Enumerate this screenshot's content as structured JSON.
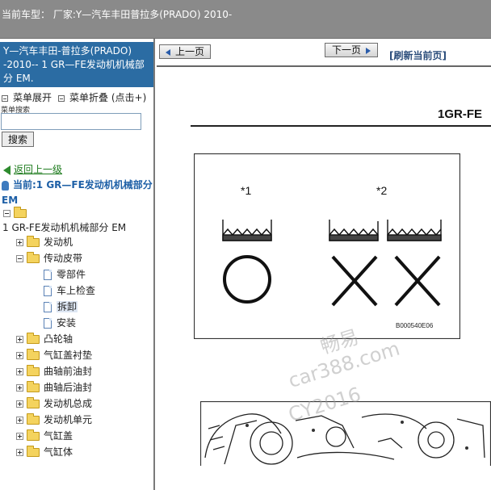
{
  "topbar": {
    "text": "当前车型：  厂家:Y—汽车丰田普拉多(PRADO) 2010-"
  },
  "sidebar": {
    "header": "Y—汽车丰田-普拉多(PRADO) -2010-- 1 GR—FE发动机机械部分 EM.",
    "expand_label": "菜单展开",
    "collapse_label": "菜单折叠 (点击+)",
    "search_label": "菜单搜索",
    "search_value": "",
    "search_button": "搜索",
    "back_label": "返回上一级",
    "current_label": "当前:1 GR—FE发动机机械部分 EM",
    "tree": {
      "root_label": "1 GR-FE发动机机械部分 EM",
      "items": [
        {
          "label": "发动机",
          "expanded": false
        },
        {
          "label": "传动皮带",
          "expanded": true
        },
        {
          "label": "零部件"
        },
        {
          "label": "车上检查"
        },
        {
          "label": "拆卸",
          "selected": true
        },
        {
          "label": "安装"
        },
        {
          "label": "凸轮轴",
          "expanded": false
        },
        {
          "label": "气缸盖衬垫",
          "expanded": false
        },
        {
          "label": "曲轴前油封",
          "expanded": false
        },
        {
          "label": "曲轴后油封",
          "expanded": false
        },
        {
          "label": "发动机总成",
          "expanded": false
        },
        {
          "label": "发动机单元",
          "expanded": false
        },
        {
          "label": "气缸盖",
          "expanded": false
        },
        {
          "label": "气缸体",
          "expanded": false
        }
      ]
    }
  },
  "content": {
    "prev_label": "上一页",
    "next_label": "下一页",
    "refresh_label": "[刷新当前页]",
    "doc_heading": "1GR-FE",
    "figure_marks": [
      "*1",
      "*2"
    ],
    "figure_code": "B000540E06"
  },
  "watermark": {
    "line1": "畅易",
    "line2": "car388.com",
    "line3": "CY2016"
  },
  "colors": {
    "topbar_bg": "#8a8a8a",
    "sidebar_header_bg": "#2b6ca3",
    "current_text": "#1d5fa6",
    "back_link": "#1c7a1c"
  }
}
